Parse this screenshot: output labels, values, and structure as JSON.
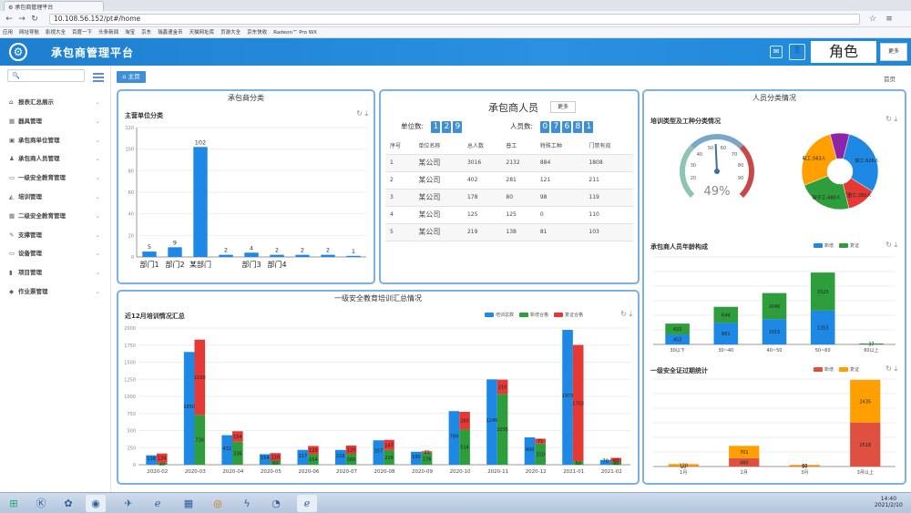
{
  "browser": {
    "tab_title": "承包商管理平台",
    "url": "10.108.56.152/pt#/home",
    "bookmarks": [
      "应用",
      "网址导航",
      "影视大全",
      "百度一下",
      "头条新闻",
      "淘宝",
      "京东",
      "瑞鑫速金币",
      "天猫网址库",
      "页游大全",
      "京东快收",
      "Radeon™ Pro WX"
    ]
  },
  "header": {
    "title": "承包商管理平台",
    "role": "角色",
    "more": "更多"
  },
  "sidebar": {
    "search_icon": "search-icon",
    "items": [
      {
        "label": "报表汇总展示",
        "icon": "home-icon"
      },
      {
        "label": "器具管理",
        "icon": "grid-icon"
      },
      {
        "label": "承包商单位管理",
        "icon": "building-icon"
      },
      {
        "label": "承包商人员管理",
        "icon": "user-icon"
      },
      {
        "label": "一级安全教育管理",
        "icon": "card-icon"
      },
      {
        "label": "培训管理",
        "icon": "cap-icon"
      },
      {
        "label": "二级安全教育管理",
        "icon": "grid-icon"
      },
      {
        "label": "支撑管理",
        "icon": "pin-icon"
      },
      {
        "label": "设备管理",
        "icon": "monitor-icon"
      },
      {
        "label": "项目管理",
        "icon": "chart-icon"
      },
      {
        "label": "作业票管理",
        "icon": "diamond-icon"
      }
    ]
  },
  "content": {
    "home_tab": "主页",
    "home_link": "首页"
  },
  "panel_category": {
    "title": "承包商分类",
    "subtitle": "主营单位分类"
  },
  "panel_people": {
    "title": "承包商人员",
    "more": "更多",
    "unit_label": "单位数:",
    "unit_digits": [
      "1",
      "2",
      "9"
    ],
    "person_label": "人员数:",
    "person_digits": [
      "0",
      "7",
      "6",
      "8",
      "1"
    ],
    "columns": [
      "序号",
      "单位名称",
      "总人数",
      "普工",
      "特殊工种",
      "门禁有效"
    ],
    "rows": [
      [
        "1",
        "某公司",
        "3016",
        "2132",
        "884",
        "1808"
      ],
      [
        "2",
        "某公司",
        "402",
        "281",
        "121",
        "211"
      ],
      [
        "3",
        "某公司",
        "178",
        "80",
        "98",
        "119"
      ],
      [
        "4",
        "某公司",
        "125",
        "125",
        "0",
        "110"
      ],
      [
        "5",
        "某公司",
        "219",
        "138",
        "81",
        "103"
      ]
    ]
  },
  "panel_staff": {
    "title": "人员分类情况",
    "subtitle": "培训类型及工种分类情况",
    "gauge_value": "49%",
    "age_subtitle": "承包商人员年龄构成",
    "cert_subtitle": "一级安全证过期统计"
  },
  "panel_training": {
    "title": "一级安全教育培训汇总情况",
    "subtitle": "近12月培训情况汇总"
  },
  "taskbar": {
    "time": "14:40",
    "date": "2021/2/10"
  },
  "chart_data": [
    {
      "id": "category",
      "type": "bar",
      "categories": [
        "部门1",
        "部门2",
        "某部门",
        "",
        "部门3",
        "部门4",
        "",
        "",
        ""
      ],
      "values": [
        5,
        9,
        102,
        2,
        4,
        2,
        2,
        2,
        1
      ],
      "ylim": [
        0,
        120
      ],
      "yticks": [
        0,
        20,
        40,
        60,
        80,
        100,
        120
      ],
      "color": "#1e88e5"
    },
    {
      "id": "gauge",
      "type": "gauge",
      "value_percent": 49,
      "label": "49%",
      "ticks": [
        20,
        30,
        40,
        50,
        60,
        70,
        80,
        90
      ]
    },
    {
      "id": "worktype",
      "type": "pie",
      "slices": [
        {
          "label": "焊工:626人",
          "value": 626,
          "color": "#1e88e5"
        },
        {
          "label": "起重工:260人",
          "value": 260,
          "color": "#e53935"
        },
        {
          "label": "架子工:480人",
          "value": 480,
          "color": "#2e9d3b"
        },
        {
          "label": "电工:563人",
          "value": 563,
          "color": "#ffa000"
        },
        {
          "label": "",
          "value": 170,
          "color": "#8e24aa"
        }
      ]
    },
    {
      "id": "age",
      "type": "bar",
      "stacked": true,
      "categories": [
        "30以下",
        "30~40",
        "40~50",
        "50~60",
        "60以上"
      ],
      "series": [
        {
          "name": "新增",
          "values": [
            402,
            861,
            1015,
            1353,
            0
          ],
          "color": "#1e88e5"
        },
        {
          "name": "复证",
          "values": [
            432,
            644,
            1040,
            1523,
            37
          ],
          "color": "#2e9d3b"
        }
      ],
      "ylim": [
        0,
        3500
      ]
    },
    {
      "id": "cert",
      "type": "bar",
      "stacked": true,
      "categories": [
        "1月",
        "2月",
        "3月",
        "3月以上"
      ],
      "series": [
        {
          "name": "新增",
          "values": [
            20,
            480,
            30,
            2518
          ],
          "color": "#e05040"
        },
        {
          "name": "复证",
          "values": [
            120,
            701,
            60,
            2435
          ],
          "color": "#ffa000"
        }
      ],
      "ylim": [
        0,
        5000
      ]
    },
    {
      "id": "training",
      "type": "bar",
      "categories": [
        "2020-02",
        "2020-03",
        "2020-04",
        "2020-05",
        "2020-06",
        "2020-07",
        "2020-08",
        "2020-09",
        "2020-10",
        "2020-11",
        "2020-12",
        "2021-01",
        "2021-02"
      ],
      "series": [
        {
          "name": "培训总数",
          "values": [
            138,
            1650,
            432,
            154,
            217,
            216,
            357,
            190,
            784,
            1249,
            400,
            1973,
            70
          ],
          "color": "#1e88e5"
        },
        {
          "name": "新增合格",
          "values": [
            30,
            730,
            336,
            60,
            154,
            160,
            216,
            176,
            514,
            1035,
            310,
            50,
            40
          ],
          "color": "#2e9d3b"
        },
        {
          "name": "复证合格",
          "values": [
            134,
            1100,
            154,
            110,
            120,
            120,
            147,
            21,
            260,
            210,
            71,
            1703,
            60
          ],
          "color": "#e53935"
        }
      ],
      "ylim": [
        0,
        2000
      ],
      "yticks": [
        0,
        250,
        500,
        750,
        1000,
        1250,
        1500,
        1750,
        2000
      ]
    }
  ]
}
